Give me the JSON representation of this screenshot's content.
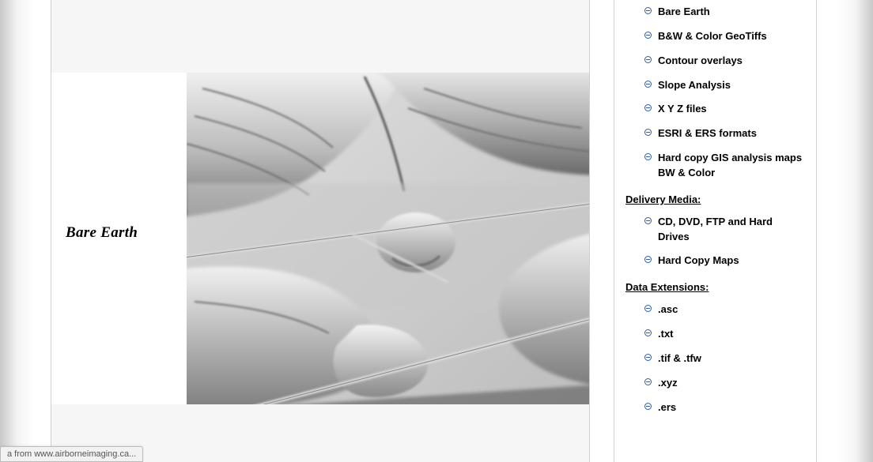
{
  "main_image": {
    "label": "Bare Earth"
  },
  "sidebar": {
    "products": [
      "Bare Earth",
      "B&W & Color GeoTiffs",
      "Contour overlays",
      "Slope Analysis",
      "X Y Z files",
      "ESRI & ERS formats",
      "Hard copy GIS analysis maps BW & Color"
    ],
    "delivery_heading": "Delivery Media:",
    "delivery": [
      "CD, DVD, FTP and Hard Drives",
      "Hard Copy Maps"
    ],
    "ext_heading": "Data Extensions:",
    "extensions": [
      ".asc",
      ".txt",
      ".tif  & .tfw",
      ".xyz",
      ".ers"
    ]
  },
  "statusbar": {
    "text": "a from www.airborneimaging.ca..."
  }
}
